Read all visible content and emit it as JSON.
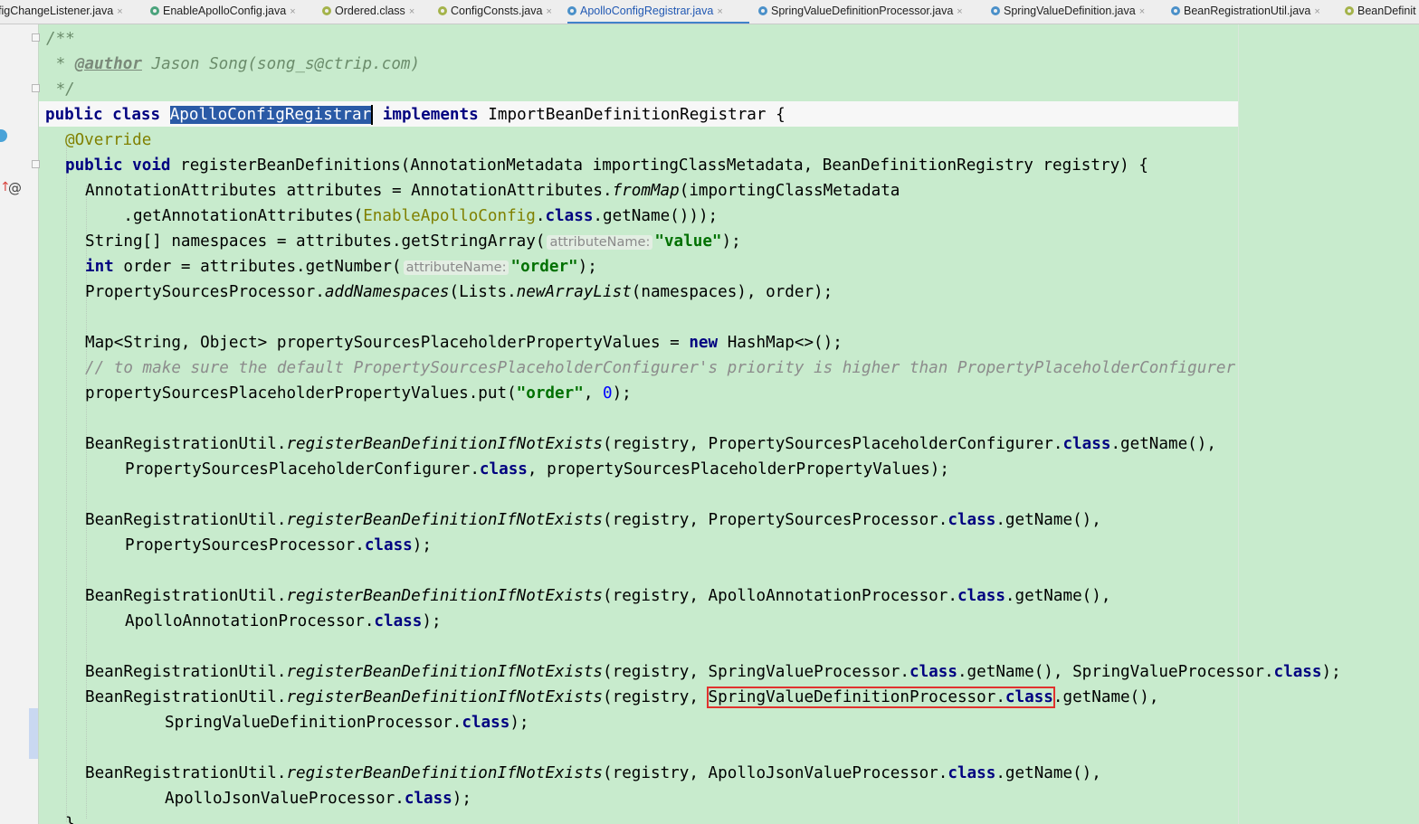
{
  "tabs": [
    {
      "label": "fig​ChangeListener.java",
      "icon": "interface-icon",
      "active": false
    },
    {
      "label": "EnableApolloConfig.java",
      "icon": "annotation-icon",
      "active": false
    },
    {
      "label": "Ordered.class",
      "icon": "interface-icon",
      "active": false
    },
    {
      "label": "ConfigConsts.java",
      "icon": "interface-icon",
      "active": false
    },
    {
      "label": "ApolloConfigRegistrar.java",
      "icon": "class-icon",
      "active": true
    },
    {
      "label": "SpringValueDefinitionProcessor.java",
      "icon": "class-icon",
      "active": false
    },
    {
      "label": "SpringValueDefinition.java",
      "icon": "class-icon",
      "active": false
    },
    {
      "label": "BeanRegistrationUtil.java",
      "icon": "class-icon",
      "active": false
    },
    {
      "label": "BeanDefinit",
      "icon": "interface-icon",
      "active": false
    }
  ],
  "tab_close_glyph": "×",
  "code": {
    "doc_open": "/**",
    "doc_star": " * ",
    "author_tag": "@author",
    "author_text": " Jason Song(song_s@ctrip.com)",
    "doc_close": " */",
    "kw_public": "public",
    "kw_class": "class",
    "class_name": "ApolloConfigRegistrar",
    "kw_implements": "implements",
    "interface_name": "ImportBeanDefinitionRegistrar {",
    "override": "@Override",
    "kw_void": "void",
    "method_sig": "registerBeanDefinitions(AnnotationMetadata importingClassMetadata, BeanDefinitionRegistry registry) {",
    "l_attr_a": "AnnotationAttributes attributes = AnnotationAttributes.",
    "l_attr_fromMap": "fromMap",
    "l_attr_b": "(importingClassMetadata",
    "l_getattr_a": "    .getAnnotationAttributes(",
    "l_getattr_enable": "EnableApolloConfig",
    "l_getattr_dot": ".",
    "kw_class_ref": "class",
    "l_getattr_b": ".getName()));",
    "l_ns_a": "String[] namespaces = attributes.getStringArray(",
    "hint_attribute_name": "attributeName:",
    "str_value": "\"value\"",
    "semi_close": ");",
    "kw_int": "int",
    "l_order_a": " order = attributes.getNumber(",
    "str_order": "\"order\"",
    "l_psp_a": "PropertySourcesProcessor.",
    "l_psp_add": "addNamespaces",
    "l_psp_b": "(Lists.",
    "l_psp_new": "newArrayList",
    "l_psp_c": "(namespaces), order);",
    "l_map_a": "Map<String, Object> propertySourcesPlaceholderPropertyValues = ",
    "kw_new": "new",
    "l_map_b": " HashMap<>();",
    "comment": "// to make sure the default PropertySourcesPlaceholderConfigurer's priority is higher than PropertyPlaceholderConfigurer",
    "l_put_a": "propertySourcesPlaceholderPropertyValues.put(",
    "l_put_b": ", ",
    "num_zero": "0",
    "brutil": "BeanRegistrationUtil.",
    "reg_method": "registerBeanDefinitionIfNotExists",
    "reg_open": "(registry, ",
    "pspc": "PropertySourcesPlaceholderConfigurer",
    "get_name_comma": ".getName(),",
    "pspc_tail": ", propertySourcesPlaceholderPropertyValues);",
    "psp": "PropertySourcesProcessor",
    "close_semi": ");",
    "aap": "ApolloAnnotationProcessor",
    "svp": "SpringValueProcessor",
    "get_name_comma_sp": ".getName(), ",
    "svdp": "SpringValueDefinitionProcessor",
    "ajvp": "ApolloJsonValueProcessor",
    "closing_brace": "}"
  }
}
